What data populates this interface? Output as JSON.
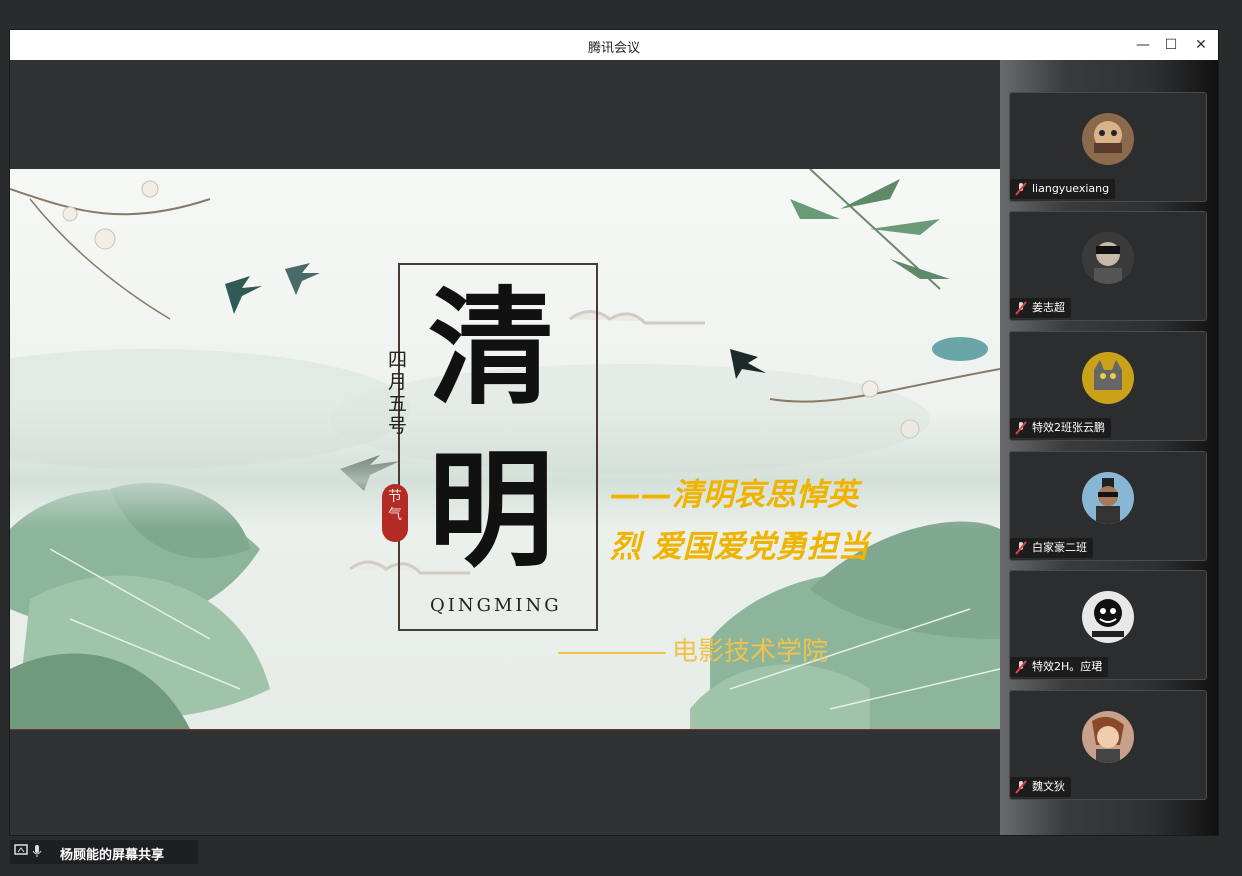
{
  "window": {
    "title": "腾讯会议",
    "minimize_glyph": "—",
    "maximize_glyph": "☐",
    "close_glyph": "✕"
  },
  "slide": {
    "title_char_1": "清",
    "title_char_2": "明",
    "date_vertical": [
      "四",
      "月",
      "五",
      "号"
    ],
    "seal_text": [
      "节",
      "气"
    ],
    "pinyin": "QINGMING",
    "slogan_line1": "——清明哀思悼英",
    "slogan_line2": "烈 爱国爱党勇担当",
    "school": "电影技术学院"
  },
  "share_bar": {
    "text": "杨顾能的屏幕共享",
    "icons": [
      "screen-share-icon",
      "microphone-icon"
    ]
  },
  "participants": [
    {
      "name": "liangyuexiang",
      "avatar_color": "#8a6a4a"
    },
    {
      "name": "姜志超",
      "avatar_color": "#3a3a3a"
    },
    {
      "name": "特效2班张云鹏",
      "avatar_color": "#c9a21a"
    },
    {
      "name": "白家豪二班",
      "avatar_color": "#8ab6d6"
    },
    {
      "name": "特效2H。应珺",
      "avatar_color": "#e8e8e8"
    },
    {
      "name": "魏文狄",
      "avatar_color": "#c9a08a"
    }
  ],
  "colors": {
    "slogan": "#f0b400",
    "muted_mic": "#e04040"
  }
}
